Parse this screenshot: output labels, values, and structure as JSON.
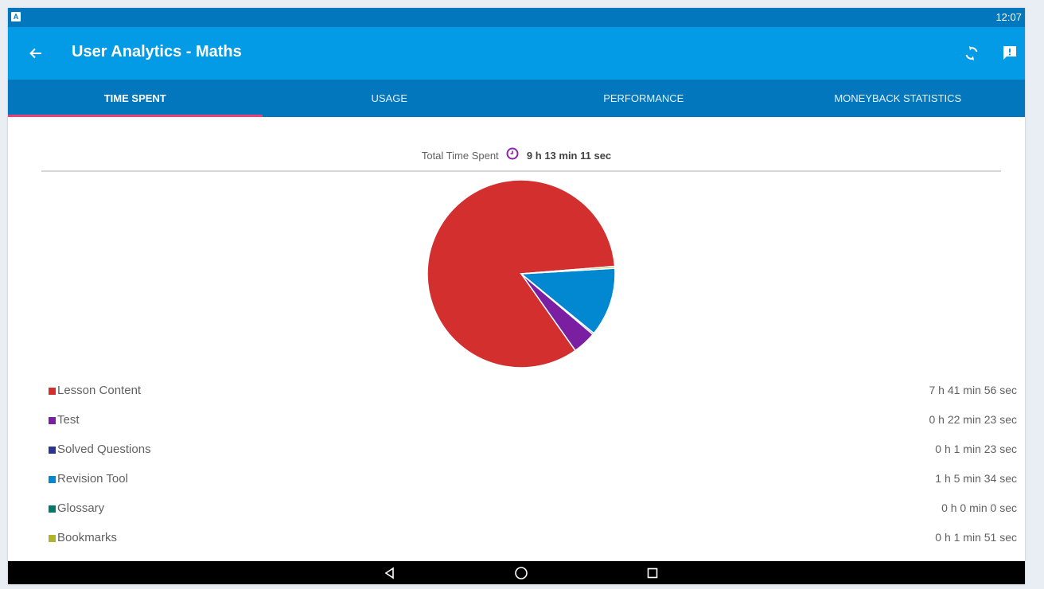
{
  "status_bar": {
    "time": "12:07",
    "app_icon": "A"
  },
  "toolbar": {
    "title": "User Analytics - Maths",
    "icons": [
      "back-arrow-icon",
      "refresh-icon",
      "feedback-icon"
    ]
  },
  "tabs": [
    {
      "label": "TIME SPENT",
      "active": true
    },
    {
      "label": "USAGE",
      "active": false
    },
    {
      "label": "PERFORMANCE",
      "active": false
    },
    {
      "label": "MONEYBACK STATISTICS",
      "active": false
    }
  ],
  "total": {
    "label": "Total Time Spent",
    "value": "9 h 13 min 11 sec"
  },
  "legend": [
    {
      "label": "Lesson Content",
      "value": "7 h 41 min 56 sec",
      "color": "#d32f2f"
    },
    {
      "label": "Test",
      "value": "0 h 22 min 23 sec",
      "color": "#7b1fa2"
    },
    {
      "label": "Solved Questions",
      "value": "0 h 1 min 23 sec",
      "color": "#283593"
    },
    {
      "label": "Revision Tool",
      "value": "1 h 5 min 34 sec",
      "color": "#0288d1"
    },
    {
      "label": "Glossary",
      "value": "0 h 0 min 0 sec",
      "color": "#00796b"
    },
    {
      "label": "Bookmarks",
      "value": "0 h 1 min 51 sec",
      "color": "#afb42b"
    }
  ],
  "chart_data": {
    "type": "pie",
    "categories": [
      "Lesson Content",
      "Test",
      "Solved Questions",
      "Revision Tool",
      "Glossary",
      "Bookmarks"
    ],
    "values": [
      27716,
      1343,
      83,
      3934,
      0,
      111
    ],
    "colors": [
      "#d32f2f",
      "#7b1fa2",
      "#283593",
      "#0288d1",
      "#00796b",
      "#afb42b"
    ]
  },
  "colors": {
    "status_bar": "#0277bd",
    "toolbar": "#039be5",
    "tab_bar": "#0277bd",
    "tab_indicator": "#ec407a",
    "clock_icon": "#8e24aa"
  },
  "nav_bar": {
    "icons": [
      "back-triangle-icon",
      "home-circle-icon",
      "recents-square-icon"
    ]
  }
}
